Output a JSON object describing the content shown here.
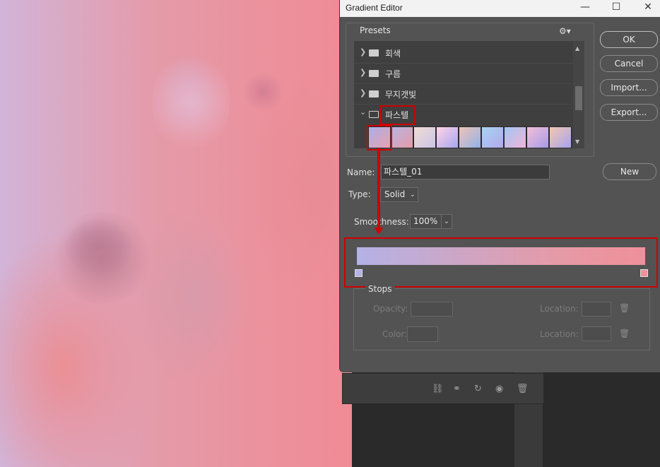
{
  "dialog": {
    "title": "Gradient Editor",
    "window_controls": {
      "minimize": "—",
      "maximize": "☐",
      "close": "✕"
    }
  },
  "presets": {
    "label": "Presets",
    "gear_icon": "⚙▾",
    "folders": [
      {
        "label": "회색",
        "expanded": false
      },
      {
        "label": "구름",
        "expanded": false
      },
      {
        "label": "무지갯빛",
        "expanded": false
      },
      {
        "label": "파스텔",
        "expanded": true
      }
    ],
    "swatch_colors": [
      [
        "#aab0e6",
        "#e9a0ae"
      ],
      [
        "#b7b5e3",
        "#e79aa6"
      ],
      [
        "#f0ddd3",
        "#cbc3e8"
      ],
      [
        "#ffd4e6",
        "#a7a6f0"
      ],
      [
        "#f1c3b6",
        "#8fb3e8"
      ],
      [
        "#a7d4f2",
        "#b3a8ee"
      ],
      [
        "#a3c7f3",
        "#f0b4d8"
      ],
      [
        "#f3bfd8",
        "#a69be7"
      ],
      [
        "#f3c8b0",
        "#a7a3ee"
      ]
    ]
  },
  "buttons": {
    "ok": "OK",
    "cancel": "Cancel",
    "import": "Import...",
    "export": "Export...",
    "new": "New"
  },
  "form": {
    "name_label": "Name:",
    "name_value": "파스텔_01",
    "type_label": "Type:",
    "type_value": "Solid",
    "smoothness_label": "Smoothness:",
    "smoothness_value": "100%"
  },
  "gradient": {
    "start_color": "#b4b2e6",
    "end_color": "#ef909a"
  },
  "stops": {
    "label": "Stops",
    "opacity_label": "Opacity:",
    "color_label": "Color:",
    "location_label_1": "Location:",
    "location_label_2": "Location:"
  },
  "colors": {
    "highlight": "#d10000",
    "dialog_bg": "#535353"
  }
}
